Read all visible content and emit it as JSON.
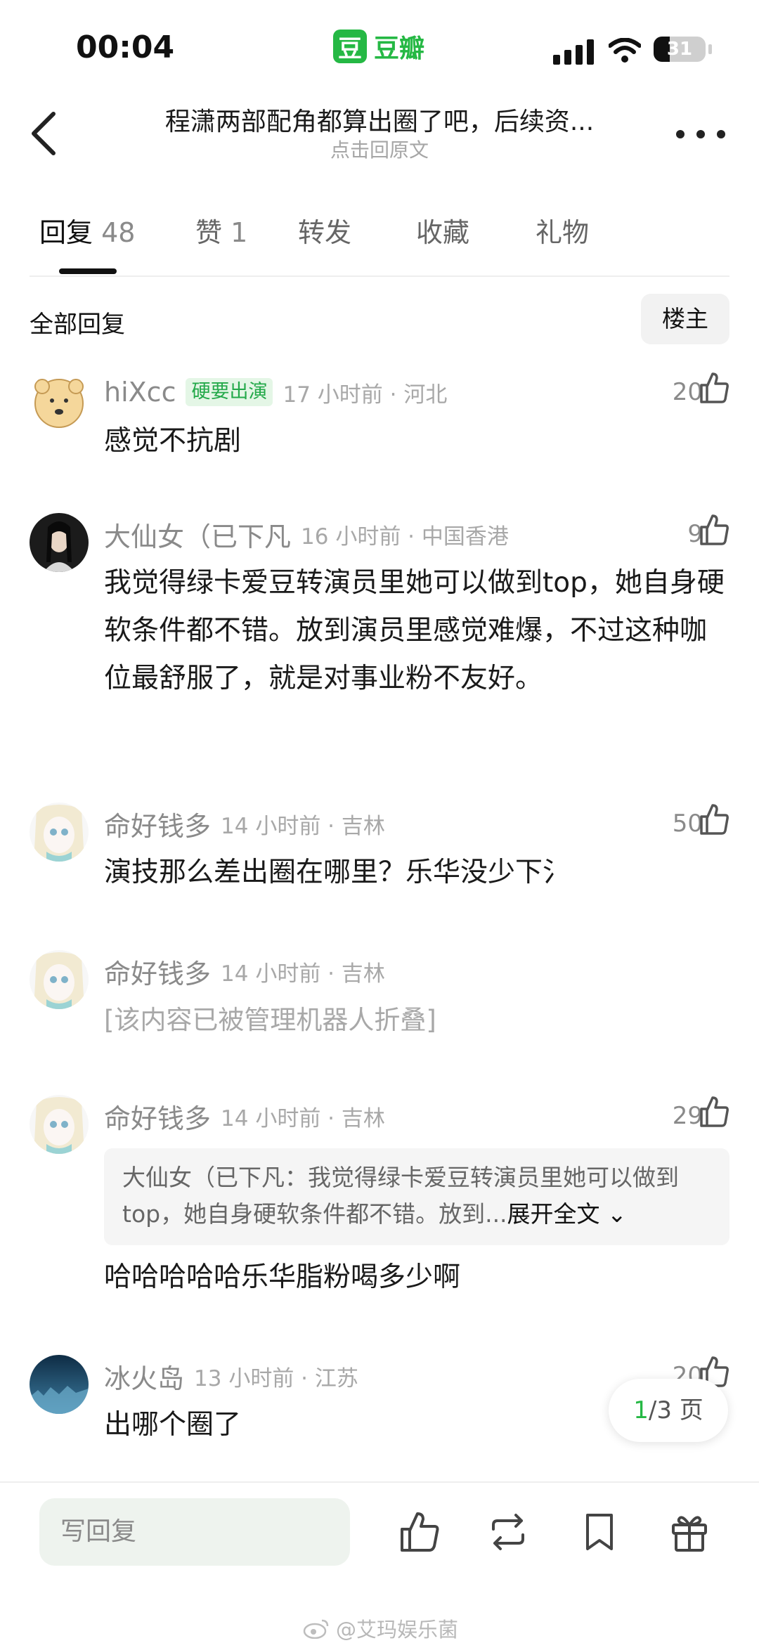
{
  "status": {
    "time": "00:04",
    "brand_logo": "豆",
    "brand_name": "豆瓣",
    "battery": "31",
    "battery_level": 0.31
  },
  "nav": {
    "title": "程潇两部配角都算出圈了吧，后续资...",
    "subtitle": "点击回原文"
  },
  "tabs": [
    {
      "label": "回复",
      "count": "48"
    },
    {
      "label": "赞",
      "count": "1"
    },
    {
      "label": "转发",
      "count": ""
    },
    {
      "label": "收藏",
      "count": ""
    },
    {
      "label": "礼物",
      "count": ""
    }
  ],
  "filter": {
    "label": "全部回复",
    "op_button": "楼主"
  },
  "comments": [
    {
      "name": "hiXcc",
      "badge": "硬要出演",
      "meta": "17 小时前 · 河北",
      "likes": "20",
      "text": "感觉不抗剧"
    },
    {
      "name": "大仙女（已下凡",
      "meta": "16 小时前 · 中国香港",
      "likes": "9",
      "text": "我觉得绿卡爱豆转演员里她可以做到top，她自身硬软条件都不错。放到演员里感觉难爆，不过这种咖位最舒服了，就是对事业粉不友好。"
    },
    {
      "name": "命好钱多",
      "meta": "14 小时前 · 吉林",
      "likes": "50",
      "text": "演技那么差出圈在哪里？乐华没少下氵"
    },
    {
      "name": "命好钱多",
      "meta": "14 小时前 · 吉林",
      "likes": "",
      "text": "[该内容已被管理机器人折叠]"
    },
    {
      "name": "命好钱多",
      "meta": "14 小时前 · 吉林",
      "likes": "29",
      "quote": "大仙女（已下凡：我觉得绿卡爱豆转演员里她可以做到top，她自身硬软条件都不错。放到...",
      "quote_expand": "展开全文",
      "text": "哈哈哈哈哈乐华脂粉喝多少啊"
    },
    {
      "name": "冰火岛",
      "meta": "13 小时前 · 江苏",
      "likes": "20",
      "text": "出哪个圈了"
    }
  ],
  "pager": {
    "current": "1",
    "total": "/3 页"
  },
  "bottom": {
    "reply_placeholder": "写回复",
    "watermark": "@艾玛娱乐菌"
  },
  "icons": [
    "back-arrow-icon",
    "more-icon",
    "thumbs-up-icon",
    "repost-icon",
    "bookmark-icon",
    "gift-icon",
    "signal-icon",
    "wifi-icon",
    "battery-icon"
  ],
  "colors": {
    "accent": "#25b844",
    "badge_bg": "#e4f6e6",
    "muted": "#8a8a8a"
  }
}
